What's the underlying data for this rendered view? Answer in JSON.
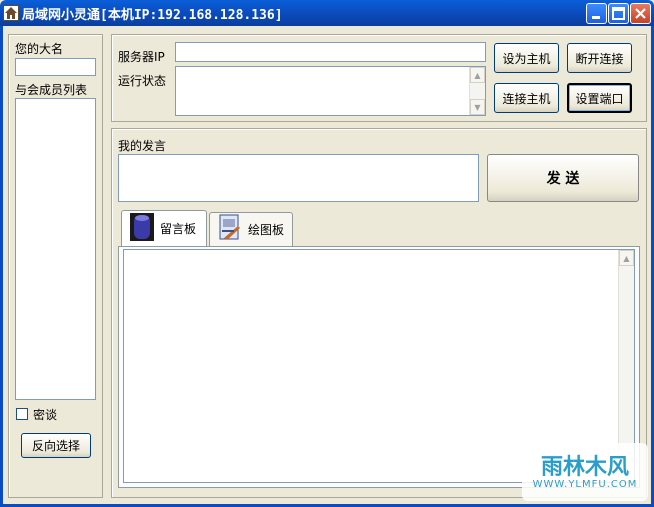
{
  "window": {
    "title": "局域网小灵通[本机IP:192.168.128.136]",
    "controls": [
      "minimize-icon",
      "maximize-icon",
      "close-icon"
    ]
  },
  "sidebar": {
    "name_label": "您的大名",
    "name_value": "",
    "members_label": "与会成员列表",
    "members": [],
    "private_label": "密谈",
    "private_checked": false,
    "invert_button": "反向选择"
  },
  "server": {
    "ip_label": "服务器IP",
    "ip_value": "",
    "status_label": "运行状态",
    "status_value": "",
    "set_host_button": "设为主机",
    "disconnect_button": "断开连接",
    "connect_host_button": "连接主机",
    "set_port_button": "设置端口"
  },
  "message": {
    "label": "我的发言",
    "value": "",
    "send_button": "发 送"
  },
  "tabs": [
    {
      "label": "留言板",
      "icon": "database-icon",
      "active": true
    },
    {
      "label": "绘图板",
      "icon": "drawing-board-icon",
      "active": false
    }
  ],
  "watermark": {
    "main": "雨林木风",
    "sub": "WWW.YLMFU.COM"
  },
  "colors": {
    "titlebar": "#0b4dc0",
    "window_bg": "#ece9d8",
    "field_border": "#7f9db9"
  }
}
